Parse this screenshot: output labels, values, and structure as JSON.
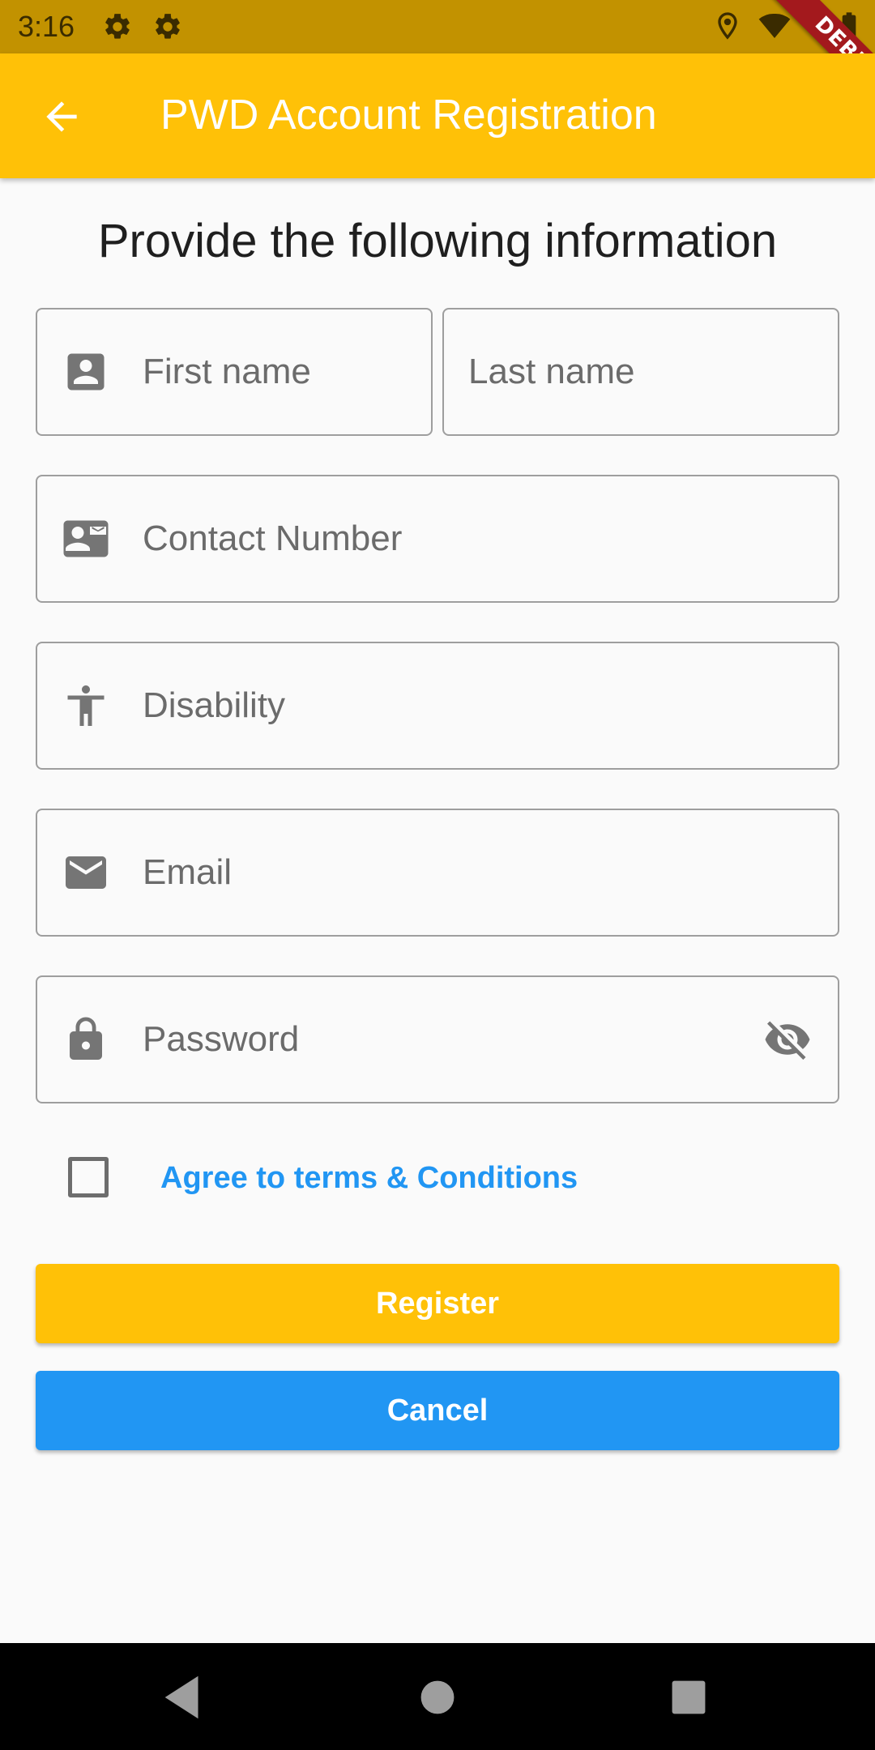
{
  "status_bar": {
    "time": "3:16",
    "left_icons": [
      "gear-icon",
      "gear-icon"
    ],
    "right_icons": [
      "location-icon",
      "wifi-icon",
      "battery-icon"
    ],
    "debug_banner": "DEBUG"
  },
  "app_bar": {
    "back_icon": "arrow-back-icon",
    "title": "PWD Account Registration",
    "background_color": "#ffc107"
  },
  "form": {
    "heading": "Provide the following information",
    "first_name": {
      "icon": "account-box-icon",
      "placeholder": "First name",
      "value": ""
    },
    "last_name": {
      "placeholder": "Last name",
      "value": ""
    },
    "contact_number": {
      "icon": "contact-card-icon",
      "placeholder": "Contact Number",
      "value": ""
    },
    "disability": {
      "icon": "accessibility-icon",
      "placeholder": "Disability",
      "value": ""
    },
    "email": {
      "icon": "email-icon",
      "placeholder": "Email",
      "value": ""
    },
    "password": {
      "icon": "lock-icon",
      "placeholder": "Password",
      "value": "",
      "toggle_icon": "visibility-off-icon"
    },
    "terms": {
      "checked": false,
      "label": "Agree to terms & Conditions",
      "color": "#2196f3"
    }
  },
  "buttons": {
    "register": {
      "label": "Register",
      "color": "#ffc107"
    },
    "cancel": {
      "label": "Cancel",
      "color": "#2196f3"
    }
  },
  "nav_bar": {
    "items": [
      "back-triangle-icon",
      "home-circle-icon",
      "recents-square-icon"
    ]
  }
}
